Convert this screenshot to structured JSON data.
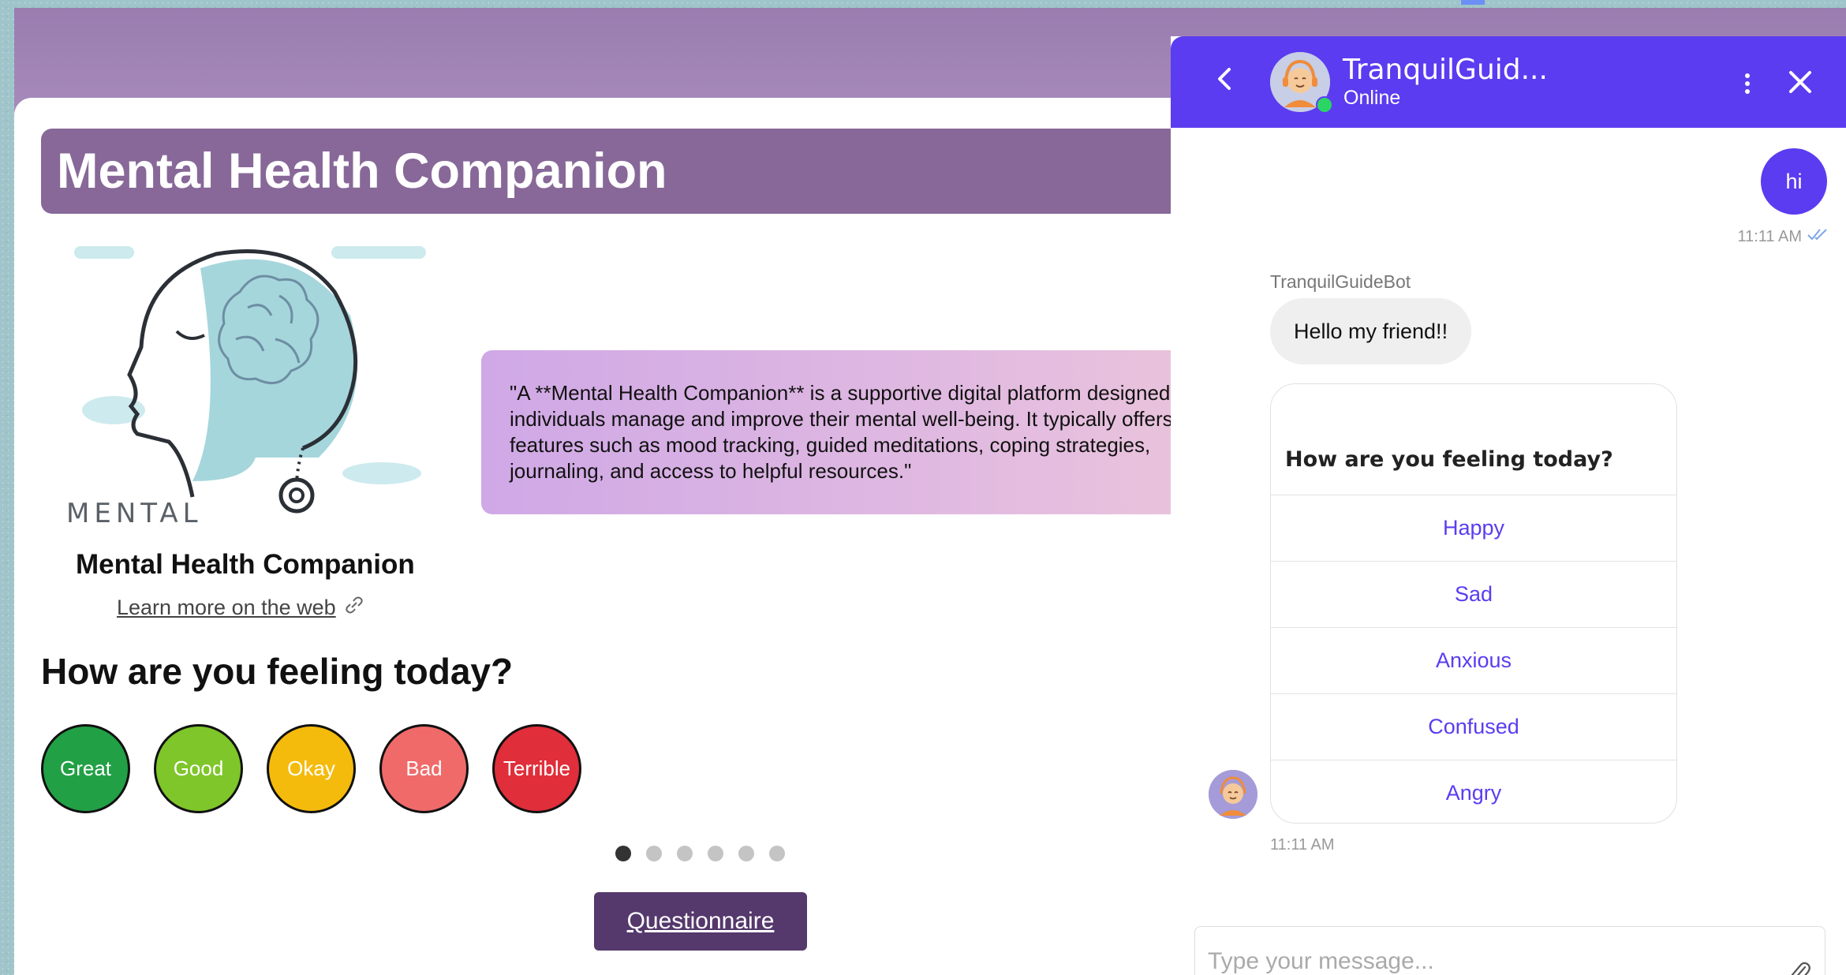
{
  "page": {
    "title": "Mental Health Companion",
    "card": {
      "logo_text": "MENTAL",
      "title": "Mental Health Companion",
      "link": "Learn more on the web"
    },
    "quote": "\"A **Mental Health Companion** is a supportive digital platform designed to help individuals manage and improve their mental well-being. It typically offers features such as mood tracking, guided meditations, coping strategies, journaling, and access to helpful resources.\"",
    "feeling_heading": "How are you feeling today?",
    "moods": [
      {
        "label": "Great",
        "color": "#22a045"
      },
      {
        "label": "Good",
        "color": "#7ec62a"
      },
      {
        "label": "Okay",
        "color": "#f5bb0c"
      },
      {
        "label": "Bad",
        "color": "#f06a6a"
      },
      {
        "label": "Terrible",
        "color": "#e02e3a"
      }
    ],
    "carousel": {
      "count": 6,
      "active": 1
    },
    "questionnaire_button": "Questionnaire"
  },
  "chat": {
    "bot_name": "TranquilGuid...",
    "status": "Online",
    "user_message": "hi",
    "user_time": "11:11 AM",
    "sender": "TranquilGuideBot",
    "bot_message": "Hello my friend!!",
    "quick_question": "How are you feeling today?",
    "quick_options": [
      "Happy",
      "Sad",
      "Anxious",
      "Confused",
      "Angry"
    ],
    "bot_time": "11:11 AM",
    "input_placeholder": "Type your message..."
  },
  "colors": {
    "accent": "#5b3cf0",
    "title_bar": "#876898",
    "top_band": "#a88cbc",
    "questionnaire": "#55386c"
  },
  "icons": [
    "back-chevron-icon",
    "bot-avatar-icon",
    "more-vertical-icon",
    "close-icon",
    "double-check-icon",
    "external-link-icon",
    "paperclip-icon"
  ]
}
